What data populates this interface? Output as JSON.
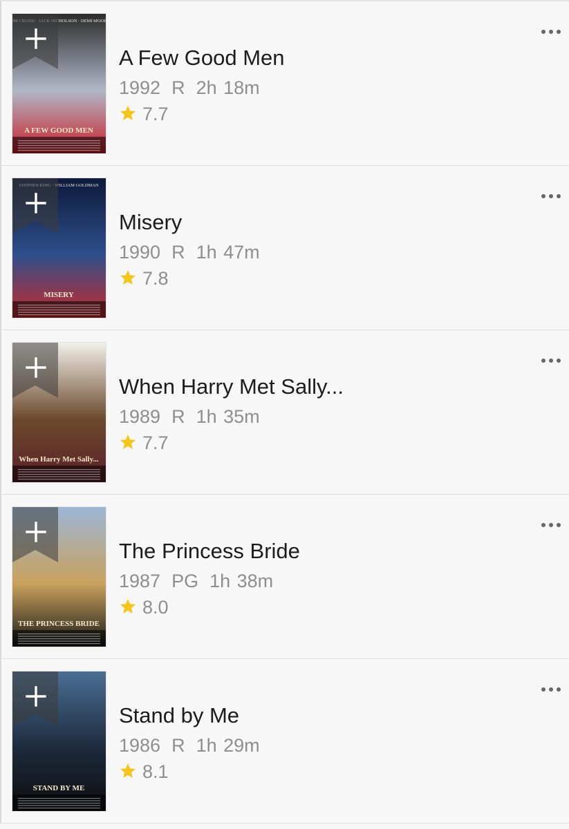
{
  "accent_color": "#f5c518",
  "movies": [
    {
      "title": "A Few Good Men",
      "year": "1992",
      "rating_mpaa": "R",
      "runtime": "2h 18m",
      "score": "7.7",
      "poster": {
        "top": "TOM CRUISE · JACK NICHOLSON · DEMI MOORE",
        "caption": "A FEW GOOD MEN",
        "palette": [
          "#2b2b2b",
          "#b0b7c7",
          "#c8202a"
        ]
      }
    },
    {
      "title": "Misery",
      "year": "1990",
      "rating_mpaa": "R",
      "runtime": "1h 47m",
      "score": "7.8",
      "poster": {
        "top": "STEPHEN KING · WILLIAM GOLDMAN",
        "caption": "MISERY",
        "palette": [
          "#0d1a3a",
          "#2e4f8c",
          "#c52b2b"
        ]
      }
    },
    {
      "title": "When Harry Met Sally...",
      "year": "1989",
      "rating_mpaa": "R",
      "runtime": "1h 35m",
      "score": "7.7",
      "poster": {
        "top": "",
        "caption": "When Harry Met Sally...",
        "palette": [
          "#f2efe9",
          "#6b4a2d",
          "#5a1f28"
        ]
      }
    },
    {
      "title": "The Princess Bride",
      "year": "1987",
      "rating_mpaa": "PG",
      "runtime": "1h 38m",
      "score": "8.0",
      "poster": {
        "top": "",
        "caption": "THE PRINCESS BRIDE",
        "palette": [
          "#9cb7d6",
          "#c9a15c",
          "#1a1a1a"
        ]
      }
    },
    {
      "title": "Stand by Me",
      "year": "1986",
      "rating_mpaa": "R",
      "runtime": "1h 29m",
      "score": "8.1",
      "poster": {
        "top": "",
        "caption": "STAND BY ME",
        "palette": [
          "#4b6e93",
          "#1d2b3d",
          "#0d0d0d"
        ]
      }
    }
  ],
  "icons": {
    "add": "plus-icon",
    "more": "ellipsis-icon",
    "star": "star-icon"
  }
}
